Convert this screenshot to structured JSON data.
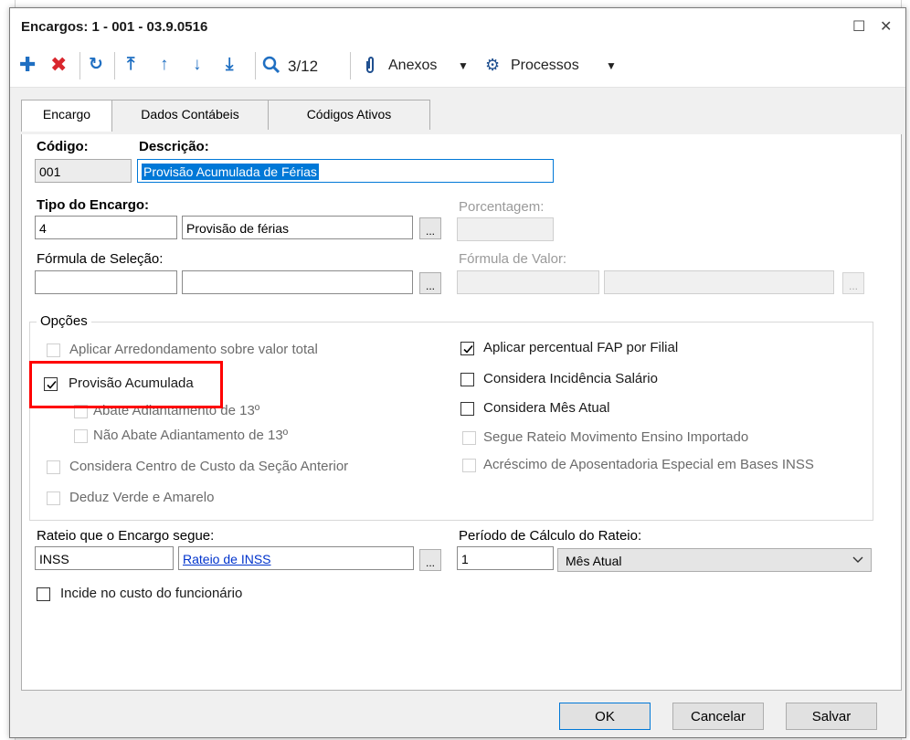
{
  "dialog": {
    "title": "Encargos: 1 - 001 - 03.9.0516",
    "restore_glyph": "☐",
    "close_glyph": "✕"
  },
  "toolbar": {
    "record_position": "3/12",
    "anexos_label": "Anexos",
    "processos_label": "Processos",
    "icons": [
      "plus-icon",
      "delete-x-icon",
      "refresh-icon",
      "first-record-icon",
      "previous-record-icon",
      "next-record-icon",
      "last-record-icon",
      "search-icon",
      "paperclip-icon",
      "gear-icon"
    ]
  },
  "tabs": [
    {
      "label": "Encargo",
      "active": true
    },
    {
      "label": "Dados Contábeis",
      "active": false
    },
    {
      "label": "Códigos Ativos",
      "active": false
    }
  ],
  "form": {
    "codigo_label": "Código:",
    "codigo_value": "001",
    "descricao_label": "Descrição:",
    "descricao_value": "Provisão Acumulada de Férias",
    "tipo_label": "Tipo do Encargo:",
    "tipo_code": "4",
    "tipo_desc": "Provisão de férias",
    "porcentagem_label": "Porcentagem:",
    "porcentagem_value": "",
    "formula_selecao_label": "Fórmula de Seleção:",
    "formula_valor_label": "Fórmula de Valor:",
    "lookup_glyph": "..."
  },
  "opcoes": {
    "title": "Opções",
    "left": [
      {
        "label": "Aplicar Arredondamento sobre valor total",
        "checked": false,
        "enabled": false
      },
      {
        "label": "Provisão Acumulada",
        "checked": true,
        "enabled": true
      },
      {
        "label": "Abate Adiantamento de 13º",
        "checked": false,
        "enabled": false
      },
      {
        "label": "Não Abate Adiantamento de 13º",
        "checked": false,
        "enabled": false
      },
      {
        "label": "Considera Centro de Custo da Seção Anterior",
        "checked": false,
        "enabled": false
      },
      {
        "label": "Deduz Verde e Amarelo",
        "checked": false,
        "enabled": false
      }
    ],
    "right": [
      {
        "label": "Aplicar percentual FAP por Filial",
        "checked": true,
        "enabled": true
      },
      {
        "label": "Considera Incidência Salário",
        "checked": false,
        "enabled": true
      },
      {
        "label": "Considera Mês Atual",
        "checked": false,
        "enabled": true
      },
      {
        "label": "Segue Rateio Movimento Ensino Importado",
        "checked": false,
        "enabled": false
      },
      {
        "label": "Acréscimo de Aposentadoria Especial em Bases INSS",
        "checked": false,
        "enabled": false
      }
    ]
  },
  "rateio": {
    "label": "Rateio que o Encargo segue:",
    "code": "INSS",
    "desc": "Rateio de INSS",
    "periodo_label": "Período de Cálculo do Rateio:",
    "periodo_value": "1",
    "periodo_option": "Mês Atual"
  },
  "incide": {
    "label": "Incide no custo do funcionário",
    "checked": false
  },
  "buttons": {
    "ok": "OK",
    "cancelar": "Cancelar",
    "salvar": "Salvar"
  },
  "colors": {
    "highlight": "#ff0000",
    "link": "#0033cc",
    "focus": "#0078d7"
  }
}
